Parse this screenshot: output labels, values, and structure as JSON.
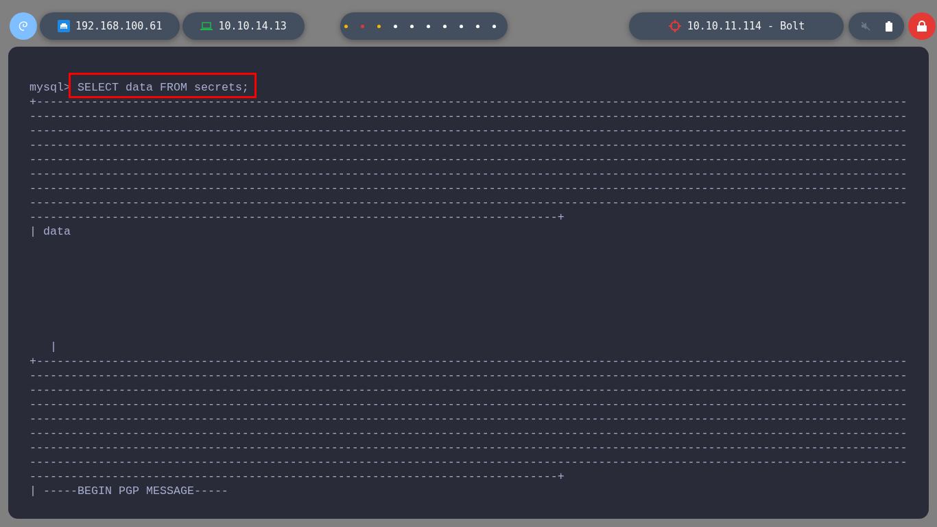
{
  "top_bar": {
    "interfaces": [
      {
        "kind": "ethernet",
        "text": "192.168.100.61"
      },
      {
        "kind": "laptop",
        "text": "10.10.14.13"
      }
    ],
    "workspaces": [
      {
        "color": "#f5b800"
      },
      {
        "color": "#e53935"
      },
      {
        "color": "#f5b800"
      },
      {
        "color": "#ffffff"
      },
      {
        "color": "#ffffff"
      },
      {
        "color": "#ffffff"
      },
      {
        "color": "#ffffff"
      },
      {
        "color": "#ffffff"
      },
      {
        "color": "#ffffff"
      },
      {
        "color": "#ffffff"
      }
    ],
    "target": {
      "text": "10.10.11.114 - Bolt"
    },
    "sound_muted": true
  },
  "terminal": {
    "prompt": "mysql>",
    "command": "SELECT data FROM secrets;",
    "command_highlighted": true,
    "output": [
      "+-------------------------------------------------------------------------------------------------------------------------------\n--------------------------------------------------------------------------------------------------------------------------------\n--------------------------------------------------------------------------------------------------------------------------------\n--------------------------------------------------------------------------------------------------------------------------------\n--------------------------------------------------------------------------------------------------------------------------------\n--------------------------------------------------------------------------------------------------------------------------------\n--------------------------------------------------------------------------------------------------------------------------------\n--------------------------------------------------------------------------------------------------------------------------------\n-----------------------------------------------------------------------------+",
      "| data\n\n\n\n\n\n\n\n   |",
      "+-------------------------------------------------------------------------------------------------------------------------------\n--------------------------------------------------------------------------------------------------------------------------------\n--------------------------------------------------------------------------------------------------------------------------------\n--------------------------------------------------------------------------------------------------------------------------------\n--------------------------------------------------------------------------------------------------------------------------------\n--------------------------------------------------------------------------------------------------------------------------------\n--------------------------------------------------------------------------------------------------------------------------------\n--------------------------------------------------------------------------------------------------------------------------------\n-----------------------------------------------------------------------------+",
      "| -----BEGIN PGP MESSAGE-----"
    ]
  }
}
